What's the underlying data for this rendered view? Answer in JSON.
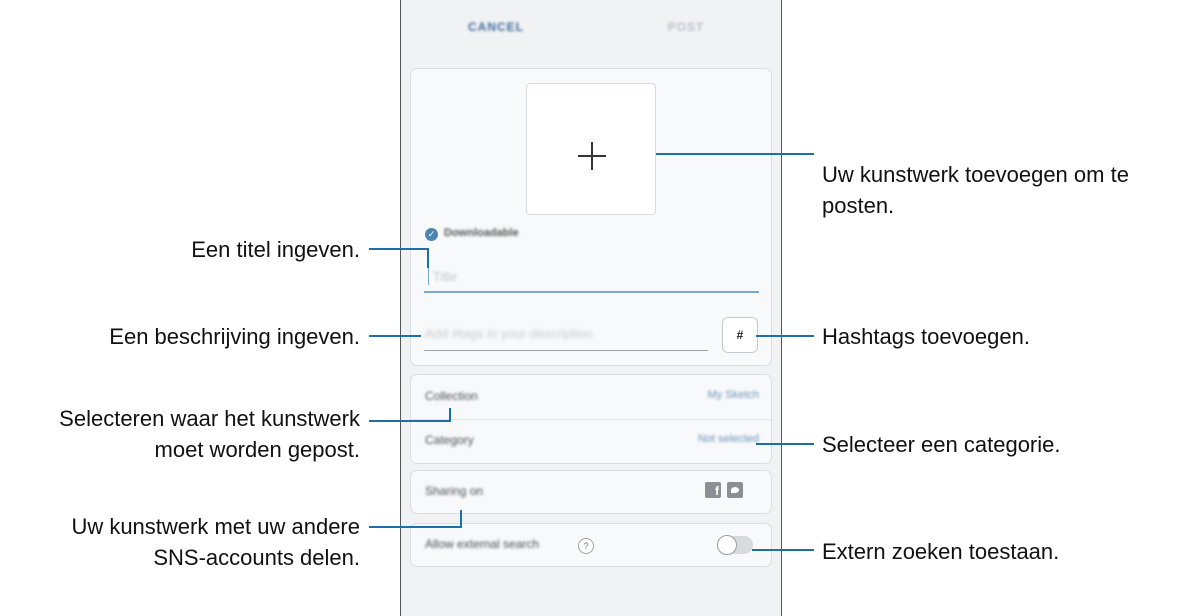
{
  "app": {
    "cancel_label": "CANCEL",
    "post_label": "POST",
    "downloadable_label": "Downloadable",
    "title_placeholder": "Title",
    "description_placeholder": "Add #tags in your description",
    "hashtag_button": "#",
    "options": [
      {
        "label": "Collection",
        "value": "My Sketch"
      },
      {
        "label": "Category",
        "value": "Not selected"
      }
    ],
    "sharing_label": "Sharing on",
    "sharing_icons": [
      "facebook-icon",
      "twitter-icon"
    ],
    "external_search_label": "Allow external search",
    "external_search_enabled": false
  },
  "callouts": {
    "add_artwork": [
      "Uw kunstwerk toevoegen om te",
      "posten."
    ],
    "enter_title": "Een titel ingeven.",
    "enter_description": "Een beschrijving ingeven.",
    "add_hashtags": "Hashtags toevoegen.",
    "select_where": [
      "Selecteren waar het kunstwerk",
      "moet worden gepost."
    ],
    "select_category": "Selecteer een categorie.",
    "share_sns": [
      "Uw kunstwerk met uw andere",
      "SNS-accounts delen."
    ],
    "external_search": "Extern zoeken toestaan."
  },
  "colors": {
    "callout_line": "#1c6fa8",
    "accent": "#4a86b3"
  }
}
